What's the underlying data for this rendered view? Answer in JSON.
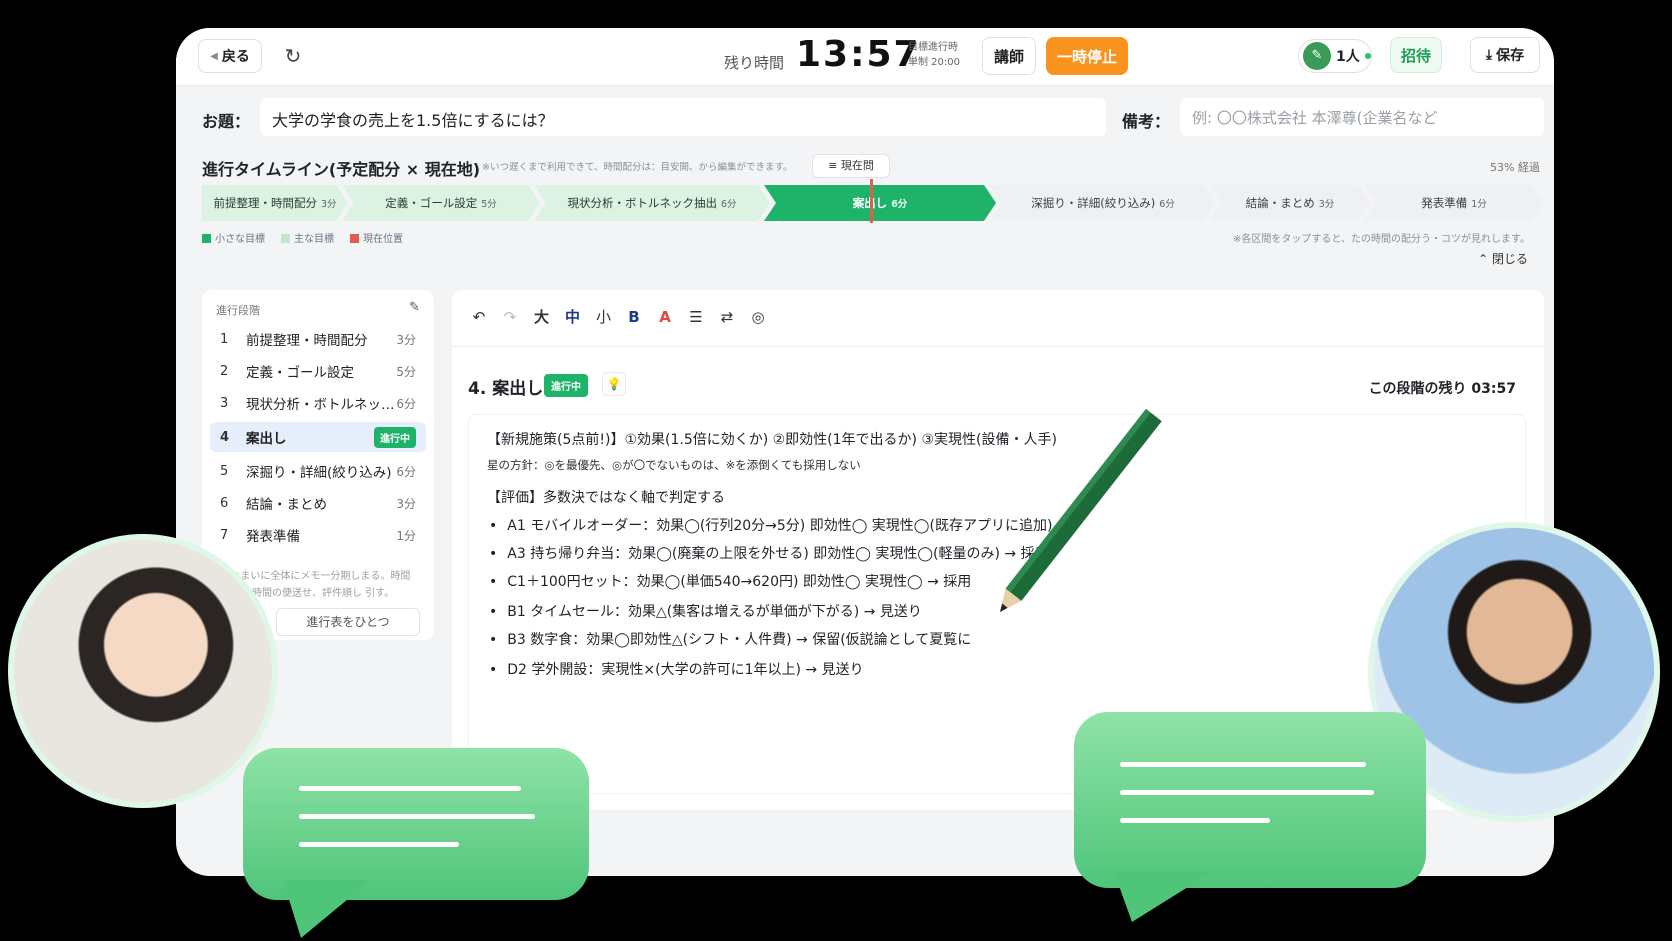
{
  "header": {
    "back_label": "戻る",
    "timer_label": "残り時間",
    "timer": "13:57",
    "timer_meta_1": "目標進行時",
    "timer_meta_2": "単制 20:00",
    "teacher_label": "講師",
    "pause_label": "一時停止",
    "members_label": "1人",
    "invite_label": "招待",
    "save_label": "保存"
  },
  "topic": {
    "label": "お題：",
    "value": "大学の学食の売上を1.5倍にするには？",
    "note_label": "備考：",
    "note_placeholder": "例: 〇〇株式会社 本澤尊(企業名など"
  },
  "timeline": {
    "title": "進行タイムライン(予定配分 × 現在地)",
    "hint": "※いつ遅くまで利用できて、時間配分は：目安開、から編集ができます。",
    "now_label": "≡ 現在問",
    "progress": "53% 経過",
    "segments": [
      {
        "label": "前提整理・時間配分",
        "min": "3分"
      },
      {
        "label": "定義・ゴール設定",
        "min": "5分"
      },
      {
        "label": "現状分析・ボトルネック抽出",
        "min": "6分"
      },
      {
        "label": "案出し",
        "min": "6分"
      },
      {
        "label": "深掘り・詳細(絞り込み)",
        "min": "6分"
      },
      {
        "label": "結論・まとめ",
        "min": "3分"
      },
      {
        "label": "発表準備",
        "min": "1分"
      }
    ],
    "legend": [
      "小さな目標",
      "主な目標",
      "現在位置"
    ],
    "tap_note": "※各区間をタップすると、たの時間の配分う・コツが見れします。",
    "collapse_label": "⌃ 閉じる"
  },
  "colors": {
    "done": "#dcf3e4",
    "active": "#1fb36a",
    "todo": "#eef0f3",
    "accent_orange": "#f7931e",
    "marker": "#e35d4f"
  },
  "sidebar": {
    "heading": "進行段階",
    "steps": [
      {
        "num": "1",
        "name": "前提整理・時間配分",
        "mins": "3分"
      },
      {
        "num": "2",
        "name": "定義・ゴール設定",
        "mins": "5分"
      },
      {
        "num": "3",
        "name": "現状分析・ボトルネック…",
        "mins": "6分"
      },
      {
        "num": "4",
        "name": "案出し",
        "badge": "進行中"
      },
      {
        "num": "5",
        "name": "深掘り・詳細(絞り込み)",
        "mins": "6分"
      },
      {
        "num": "6",
        "name": "結論・まとめ",
        "mins": "3分"
      },
      {
        "num": "7",
        "name": "発表準備",
        "mins": "1分"
      }
    ],
    "footnote_1": "※まいに全体にメモ一分期しまる。時間",
    "footnote_2": "ご、時間の便送せ、評件順し 引す。",
    "button_label": "進行表をひとつ"
  },
  "editor": {
    "toolbar": [
      "↶",
      "↷",
      "大",
      "中",
      "小",
      "B",
      "A",
      "☰",
      "⇄",
      "◎"
    ],
    "section_title": "4. 案出し",
    "section_badge": "進行中",
    "remaining": "この段階の残り 03:57",
    "lines": {
      "header": "【新規施策(5点前!)】①効果(1.5倍に効くか) ②即効性(1年で出るか) ③実現性(設備・人手)",
      "policy": "星の方針：◎を最優先、◎が〇でないものは、※を添倒くても採用しない",
      "eval": "【評価】多数決ではなく軸で判定する",
      "items": [
        "A1 モバイルオーダー：効果◯(行列20分→5分) 即効性◯ 実現性◯(既存アプリに追加) →",
        "A3 持ち帰り弁当：効果◯(廃棄の上限を外せる) 即効性◯ 実現性◯(軽量のみ) → 採用",
        "C1＋100円セット：効果◯(単価540→620円) 即効性◯ 実現性◯ → 採用",
        "B1 タイムセール：効果△(集客は増えるが単価が下がる) → 見送り",
        "B3 数字食：効果◯即効性△(シフト・人件費) → 保留(仮説論として夏覧に",
        "D2 学外開設：実現性×(大学の許可に1年以上) → 見送り"
      ]
    }
  }
}
